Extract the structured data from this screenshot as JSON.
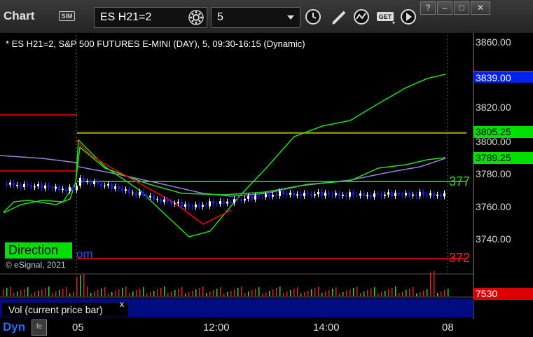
{
  "app": {
    "logo_text": "Chart",
    "sim_badge": "SIM"
  },
  "toolbar": {
    "symbol": "ES H21=2",
    "interval": "5",
    "icons": [
      "gear-icon",
      "clock-icon",
      "pencil-icon",
      "indicator-icon",
      "get-icon",
      "play-icon"
    ],
    "window_buttons": [
      "?",
      "–",
      "□",
      "✕"
    ]
  },
  "chart": {
    "title": "* ES H21=2, S&P 500 FUTURES E-MINI (DAY), 5, 09:30-16:15 (Dynamic)",
    "watermark": "© eSignal, 2021",
    "direction_label": "Direction",
    "partial_text": "om",
    "overlay_labels": [
      "377",
      "372"
    ],
    "price_axis": [
      "3860.00",
      "3839.00",
      "3820.00",
      "3805.25",
      "3800.00",
      "3789.25",
      "3780.00",
      "3760.00",
      "3740.00"
    ],
    "tags": {
      "last_price": "3839.00",
      "green_level": "3805.25",
      "ma_level": "3789.25"
    },
    "colors": {
      "up": "#ffffff",
      "down": "#1a1aff",
      "level_red": "#ff0000",
      "level_green": "#00ff00",
      "ma_purple": "#9b7fd9",
      "ma_green": "#22dd22"
    }
  },
  "volume": {
    "label": "Vol (current price bar)",
    "close": "x",
    "value_tag": "7530"
  },
  "time_axis": {
    "labels": [
      "05",
      "12:00",
      "14:00",
      "08"
    ]
  },
  "footer": {
    "dyn": "Dyn"
  }
}
